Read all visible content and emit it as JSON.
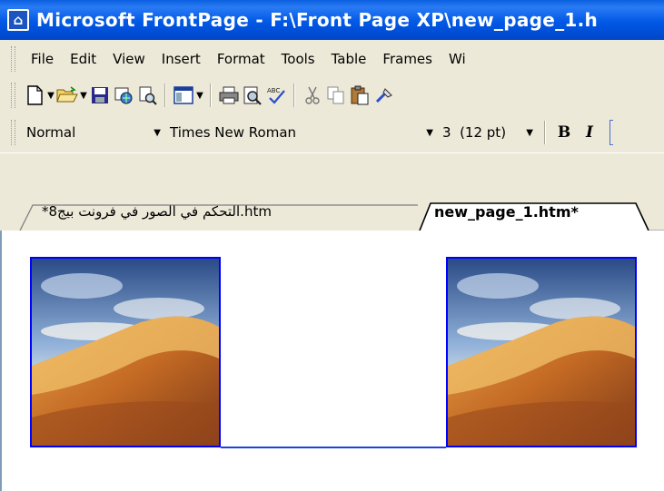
{
  "window": {
    "title": "Microsoft FrontPage - F:\\Front Page XP\\new_page_1.h",
    "icon": "frontpage-app-icon"
  },
  "menu": {
    "items": [
      {
        "label": "File"
      },
      {
        "label": "Edit"
      },
      {
        "label": "View"
      },
      {
        "label": "Insert"
      },
      {
        "label": "Format"
      },
      {
        "label": "Tools"
      },
      {
        "label": "Table"
      },
      {
        "label": "Frames"
      },
      {
        "label": "Wi"
      }
    ]
  },
  "toolbar": {
    "buttons": [
      "new-page-icon",
      "open-folder-icon",
      "save-icon",
      "publish-web-icon",
      "search-icon",
      "toggle-pane-icon",
      "print-icon",
      "print-preview-icon",
      "spelling-icon",
      "cut-icon",
      "copy-icon",
      "paste-icon",
      "format-painter-icon"
    ]
  },
  "format": {
    "style": "Normal",
    "font": "Times New Roman",
    "size": "3  (12 pt)",
    "bold": "B",
    "italic": "I"
  },
  "tabs": [
    {
      "label": "*التحكم في الصور في فرونت بيج8.htm",
      "active": false
    },
    {
      "label": "new_page_1.htm*",
      "active": true
    }
  ],
  "colors": {
    "title_bar": "#0058e6",
    "picture_border": "#0000ff",
    "horizontal_rule": "#2040e0"
  }
}
